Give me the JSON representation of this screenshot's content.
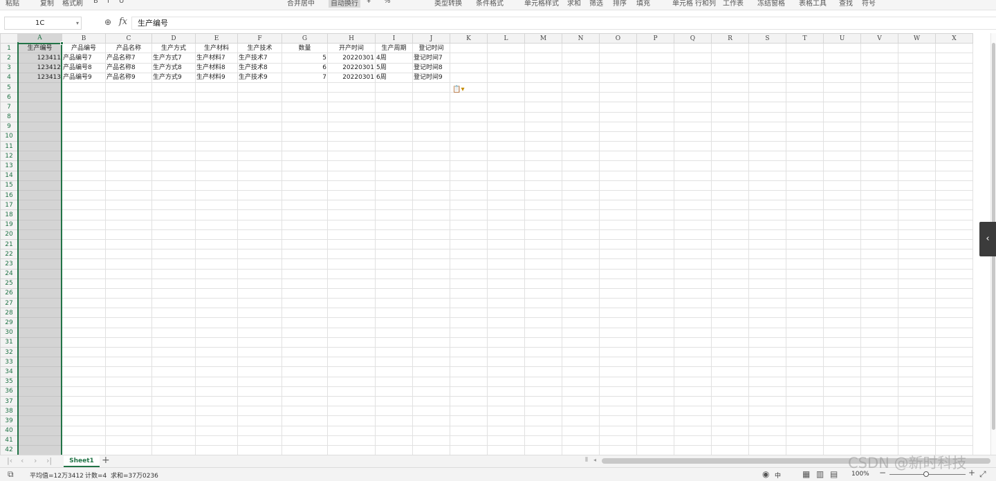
{
  "ribbon": {
    "items": [
      {
        "label": "粘贴"
      },
      {
        "label": "复制"
      },
      {
        "label": "格式刷"
      },
      {
        "label": "B"
      },
      {
        "label": "I"
      },
      {
        "label": "U"
      },
      {
        "label": "合并居中"
      },
      {
        "label": "自动换行"
      },
      {
        "label": "¥"
      },
      {
        "label": "%"
      },
      {
        "label": "类型转换"
      },
      {
        "label": "条件格式"
      },
      {
        "label": "单元格样式"
      },
      {
        "label": "求和"
      },
      {
        "label": "筛选"
      },
      {
        "label": "排序"
      },
      {
        "label": "填充"
      },
      {
        "label": "单元格"
      },
      {
        "label": "行和列"
      },
      {
        "label": "工作表"
      },
      {
        "label": "冻结窗格"
      },
      {
        "label": "表格工具"
      },
      {
        "label": "查找"
      },
      {
        "label": "符号"
      }
    ]
  },
  "formula_bar": {
    "name_box": "1C",
    "fx_label": "fx",
    "content": "生产编号"
  },
  "sheet": {
    "columns": [
      "A",
      "B",
      "C",
      "D",
      "E",
      "F",
      "G",
      "H",
      "I",
      "J",
      "K",
      "L",
      "M",
      "N",
      "O",
      "P",
      "Q",
      "R",
      "S",
      "T",
      "U",
      "V",
      "W",
      "X"
    ],
    "header_row": [
      "生产编号",
      "产品编号",
      "产品名称",
      "生产方式",
      "生产材料",
      "生产技术",
      "数量",
      "开产时间",
      "生产周期",
      "登记时间"
    ],
    "rows": [
      [
        "123411",
        "产品编号7",
        "产品名称7",
        "生产方式7",
        "生产材料7",
        "生产技术7",
        "5",
        "20220301",
        "4周",
        "登记时间7"
      ],
      [
        "123412",
        "产品编号8",
        "产品名称8",
        "生产方式8",
        "生产材料8",
        "生产技术8",
        "6",
        "20220301",
        "5周",
        "登记时间8"
      ],
      [
        "123413",
        "产品编号9",
        "产品名称9",
        "生产方式9",
        "生产材料9",
        "生产技术9",
        "7",
        "20220301",
        "6周",
        "登记时间9"
      ]
    ],
    "row_count": 42,
    "selected_column": "A"
  },
  "tabs": {
    "sheets": [
      "Sheet1"
    ],
    "active": "Sheet1",
    "add_label": "+"
  },
  "status": {
    "average": "平均值=12万3412",
    "count": "计数=4",
    "sum": "求和=37万0236",
    "zoom": "100%",
    "ime": "中"
  },
  "watermark": "CSDN @新时科技"
}
